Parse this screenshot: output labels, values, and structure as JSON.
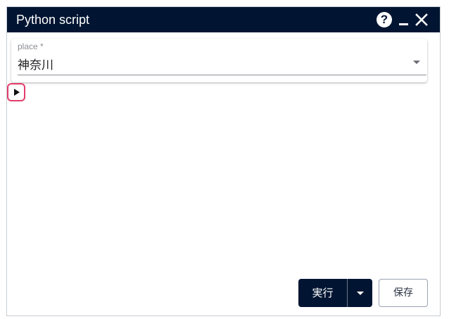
{
  "window": {
    "title": "Python script",
    "help_icon": "help-icon",
    "minimize_icon": "minimize-icon",
    "close_icon": "close-icon",
    "colors": {
      "titlebar": "#011532",
      "title_text": "#ffffff",
      "highlight": "#e23d6b"
    }
  },
  "form": {
    "place": {
      "label": "place *",
      "value": "神奈川",
      "dropdown_icon": "chevron-down-icon"
    }
  },
  "expand_toggle": {
    "icon": "play-triangle-icon"
  },
  "footer": {
    "run_label": "実行",
    "run_menu_icon": "caret-down-icon",
    "save_label": "保存"
  }
}
